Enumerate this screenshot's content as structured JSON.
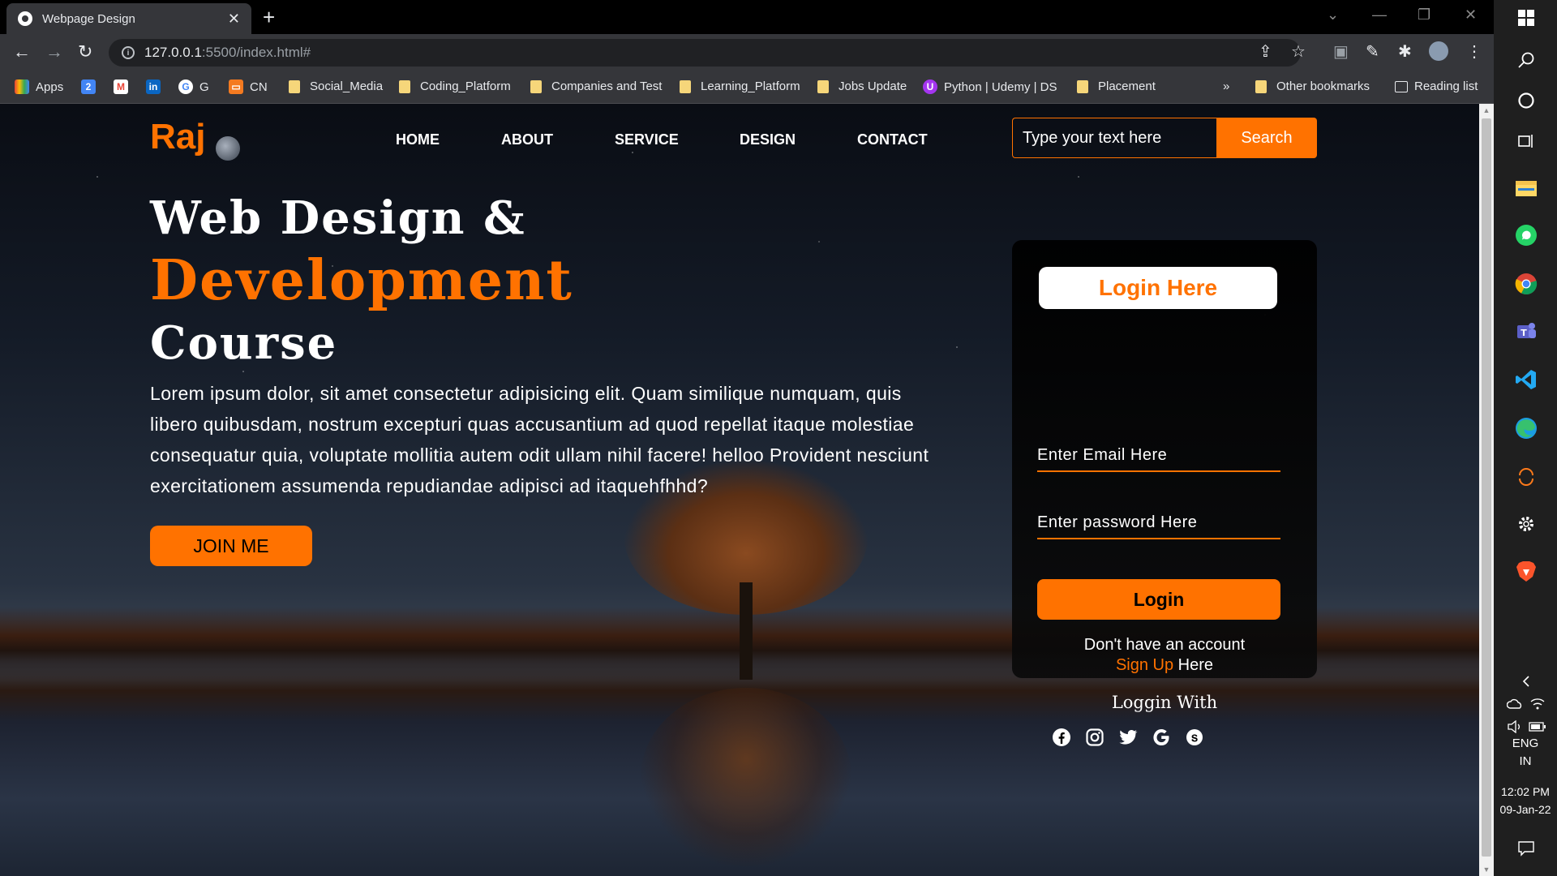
{
  "browser": {
    "tab_title": "Webpage Design",
    "url_host": "127.0.0.1",
    "url_path": ":5500/index.html#",
    "bookmarks": [
      {
        "label": "Apps",
        "icon": "apps-grid-icon"
      },
      {
        "label": "",
        "icon": "calendar-icon"
      },
      {
        "label": "",
        "icon": "gmail-icon"
      },
      {
        "label": "",
        "icon": "linkedin-icon"
      },
      {
        "label": "G",
        "icon": "google-icon"
      },
      {
        "label": "CN",
        "icon": "cn-icon"
      },
      {
        "label": "Social_Media",
        "icon": "folder-icon"
      },
      {
        "label": "Coding_Platform",
        "icon": "folder-icon"
      },
      {
        "label": "Companies and Test",
        "icon": "folder-icon"
      },
      {
        "label": "Learning_Platform",
        "icon": "folder-icon"
      },
      {
        "label": "Jobs Update",
        "icon": "folder-icon"
      },
      {
        "label": "Python | Udemy | DS",
        "icon": "udemy-icon"
      },
      {
        "label": "Placement",
        "icon": "folder-icon"
      }
    ],
    "overflow_label": "»",
    "other_bookmarks": "Other bookmarks",
    "reading_list": "Reading list"
  },
  "page": {
    "brand": "Raj",
    "menu": [
      "HOME",
      "ABOUT",
      "SERVICE",
      "DESIGN",
      "CONTACT"
    ],
    "search_placeholder": "Type your text here",
    "search_button": "Search",
    "hero_line1": "Web Design &",
    "hero_line2": "Development",
    "hero_line3": "Course",
    "hero_paragraph": "Lorem ipsum dolor, sit amet consectetur adipisicing elit. Quam similique numquam, quis libero quibusdam, nostrum excepturi quas accusantium ad quod repellat itaque molestiae consequatur quia, voluptate mollitia autem odit ullam nihil facere! helloo Provident nesciunt exercitationem assumenda repudiandae adipisci ad itaquehfhhd?",
    "join_button": "JOIN ME",
    "login": {
      "title": "Login Here",
      "email_placeholder": "Enter Email Here",
      "password_placeholder": "Enter password Here",
      "login_button": "Login",
      "no_account": "Don't have an account",
      "signup_link": "Sign Up",
      "signup_suffix": " Here",
      "loggin_with": "Loggin With",
      "socials": [
        "facebook-icon",
        "instagram-icon",
        "twitter-icon",
        "google-icon",
        "skype-icon"
      ]
    }
  },
  "taskbar": {
    "lang_1": "ENG",
    "lang_2": "IN",
    "time": "12:02 PM",
    "date": "09-Jan-22",
    "apps": [
      "windows-start-icon",
      "search-icon",
      "cortana-icon",
      "task-view-icon",
      "file-explorer-icon",
      "whatsapp-icon",
      "chrome-icon",
      "teams-icon",
      "vscode-icon",
      "edge-icon",
      "sync-icon",
      "settings-icon",
      "brave-icon"
    ]
  },
  "colors": {
    "accent": "#ff7200",
    "chrome_dark": "#35363a",
    "taskbar": "#1f1f1f"
  }
}
